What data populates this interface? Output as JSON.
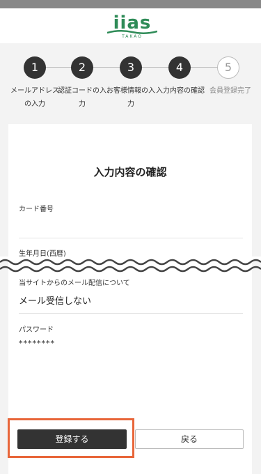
{
  "header": {
    "logo_text": "iias",
    "logo_sub": "TAKAO"
  },
  "steps": [
    {
      "number": "1",
      "label": "メールアドレスの入力",
      "state": "done"
    },
    {
      "number": "2",
      "label": "認証コードの入力",
      "state": "done"
    },
    {
      "number": "3",
      "label": "お客様情報の入力",
      "state": "done"
    },
    {
      "number": "4",
      "label": "入力内容の確認",
      "state": "current"
    },
    {
      "number": "5",
      "label": "会員登録完了",
      "state": "todo"
    }
  ],
  "form": {
    "title": "入力内容の確認",
    "card_number_label": "カード番号",
    "card_number_value": "",
    "birthdate_label": "生年月日(西暦)",
    "mail_label": "当サイトからのメール配信について",
    "mail_value": "メール受信しない",
    "password_label": "パスワード",
    "password_value": "********"
  },
  "buttons": {
    "register_label": "登録する",
    "back_label": "戻る"
  },
  "colors": {
    "brand_green": "#2e8b57",
    "step_active": "#333333",
    "highlight": "#e8663a"
  }
}
